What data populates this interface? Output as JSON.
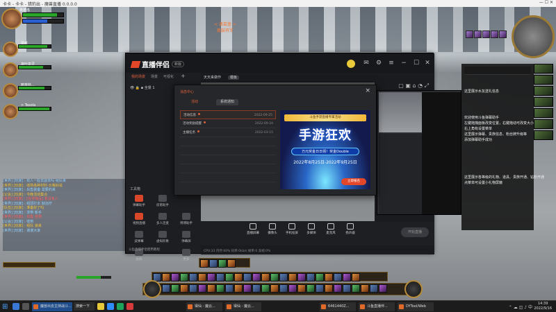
{
  "host_window": {
    "title": "卡卡 - 卡卡 - 猎豹出 - 魔兽直播 0.0.0.0"
  },
  "game": {
    "top_notice": [
      "< 诸葛盏 >",
      "黄鼓将军"
    ],
    "party": [
      {
        "name": "奥德洛"
      },
      {
        "name": "雷纸"
      },
      {
        "name": "夜叶泉灵"
      },
      {
        "name": "暗夜盐..."
      },
      {
        "name": "> Tesola"
      }
    ],
    "chat_lines": [
      "[世界] [玩家] : 有人一起去副本吗 组队来",
      "[世界] [玩家] : 收购各种材料 价格好说",
      "[世界] [玩家] : 出售装备 需要的来",
      "[公会] [玩家] : 今晚活动集合",
      "[世界] [玩家] : [任务物品] 有没有人",
      "[世界] [玩家] : 组团打本 缺治疗",
      "[队伍] [玩家] : 准备好了吗",
      "[世界] [玩家] : 求带 新手",
      "[世界] [玩家] : 出售 坐骑",
      "[公会] [玩家] : 收到",
      "[世界] [玩家] : 组队 速来",
      "[世界] [玩家] : 谢谢大家"
    ],
    "side_panel": {
      "lines": [
        "这里展示水友送礼信息",
        "欢迎使用斗鱼弹幕助手",
        "左键拖拽面板改变位置，右键拖动可改变大小",
        "右上角有设置菜单",
        "这里展示弹幕、贵族信息、粉丝牌升级等",
        "添加弹幕助手成功",
        "这里展示各等级的礼物、道具、贵族开通、钻粉开通",
        "点菜单可设置小礼物屏蔽"
      ]
    }
  },
  "app": {
    "name": "直播伴侣",
    "version_badge": "新版",
    "nav_tabs": [
      "我的场景",
      "场景",
      "可视化"
    ],
    "scene_row": "全景 1",
    "tools_title": "工具箱",
    "tools": [
      "弹幕助手",
      "房管助手",
      "视频直播",
      "多人连麦",
      "博博助手",
      "波弹幕",
      "虚拟形象",
      "弹幕屏",
      "投屏",
      "更多"
    ],
    "preview_tabs": [
      "天天来做作",
      "模板"
    ],
    "bottom_tools": [
      "直播屏幕",
      "摄像头",
      "手机投屏",
      "多媒体",
      "麦克风",
      "扬声器"
    ],
    "start_button": "开始直播",
    "status": "CPU:33  内存:60%  码率:0kb/s  帧率:0  丢帧:0%",
    "left_status": "斗鱼直播伴侣使用教程"
  },
  "modal": {
    "title": "消息中心",
    "tabs": [
      "活动",
      "系统通知"
    ],
    "messages": [
      {
        "title": "活动信息",
        "date": "2022-09-25",
        "selected": true
      },
      {
        "title": "活动奖励提醒",
        "date": "2022-09-24",
        "selected": false
      },
      {
        "title": "主播任务",
        "date": "2022-03-15",
        "selected": false
      }
    ],
    "banner": {
      "top": "斗鱼手游直播专属活动",
      "title": "手游狂欢",
      "pill": "万元奖金日日领！奖金Double",
      "date": "2022年8月25日-2022年9月25日",
      "button": "立即报名"
    }
  },
  "taskbar": {
    "search_text": "搜索一下",
    "items": [
      "魔兽出去主持战斗...",
      "得仙 - 魔云...",
      "得仙 - 魔云...",
      "6461440Z...",
      "斗鱼直播伴...",
      "DYTool/Web"
    ],
    "time": "14:39",
    "date": "2022/9/16"
  },
  "colors": {
    "accent": "#e0603a",
    "app_bg": "#1d1e22",
    "banner_blue": "#2a68c8"
  }
}
